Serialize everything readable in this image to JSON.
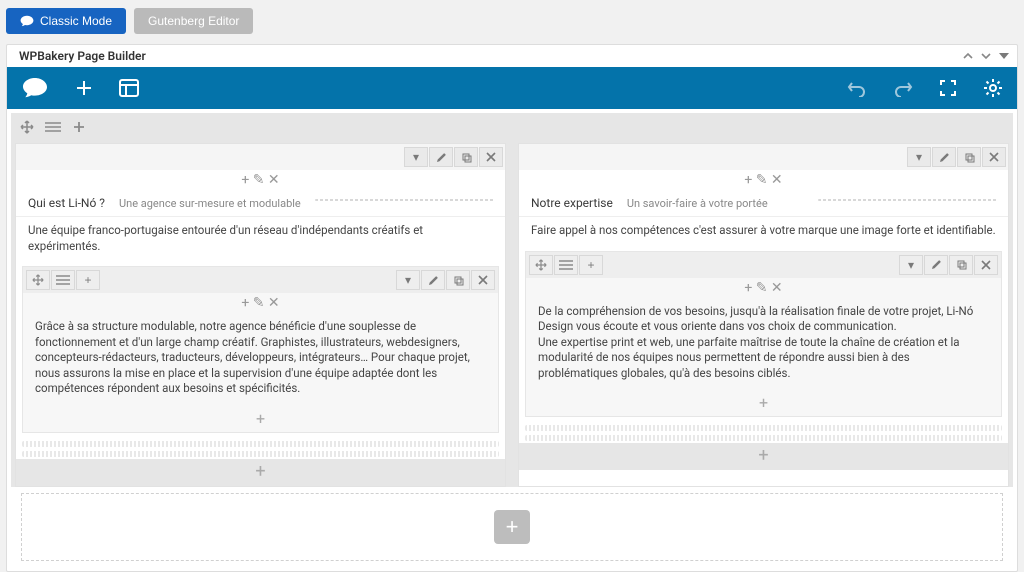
{
  "buttons": {
    "classic_mode": "Classic Mode",
    "gutenberg": "Gutenberg Editor"
  },
  "panel": {
    "title": "WPBakery Page Builder"
  },
  "columns": [
    {
      "heading_title": "Qui est Li-Nó ?",
      "heading_subtitle": "Une agence sur-mesure et modulable",
      "intro": "Une équipe franco-portugaise entourée d'un réseau d'indépendants créatifs et expérimentés.",
      "body": "Grâce à sa structure modulable, notre agence bénéficie d'une souplesse de fonctionnement et d'un large champ créatif. Graphistes, illustrateurs, webdesigners, concepteurs-rédacteurs, traducteurs, développeurs, intégrateurs… Pour chaque projet, nous assurons la mise en place et la supervision d'une équipe adaptée dont les compétences répondent aux besoins et spécificités."
    },
    {
      "heading_title": "Notre expertise",
      "heading_subtitle": "Un savoir-faire à votre portée",
      "intro": "Faire appel à nos compétences c'est assurer à votre marque une image forte et identifiable.",
      "body": "De la compréhension de vos besoins, jusqu'à la réalisation finale de votre projet, Li-Nó Design vous écoute et vous oriente dans vos choix de communication.\nUne expertise print et web, une parfaite maîtrise de toute la chaîne de création et la modularité de nos équipes nous permettent de répondre aussi bien à des problématiques globales, qu'à des besoins ciblés."
    }
  ]
}
